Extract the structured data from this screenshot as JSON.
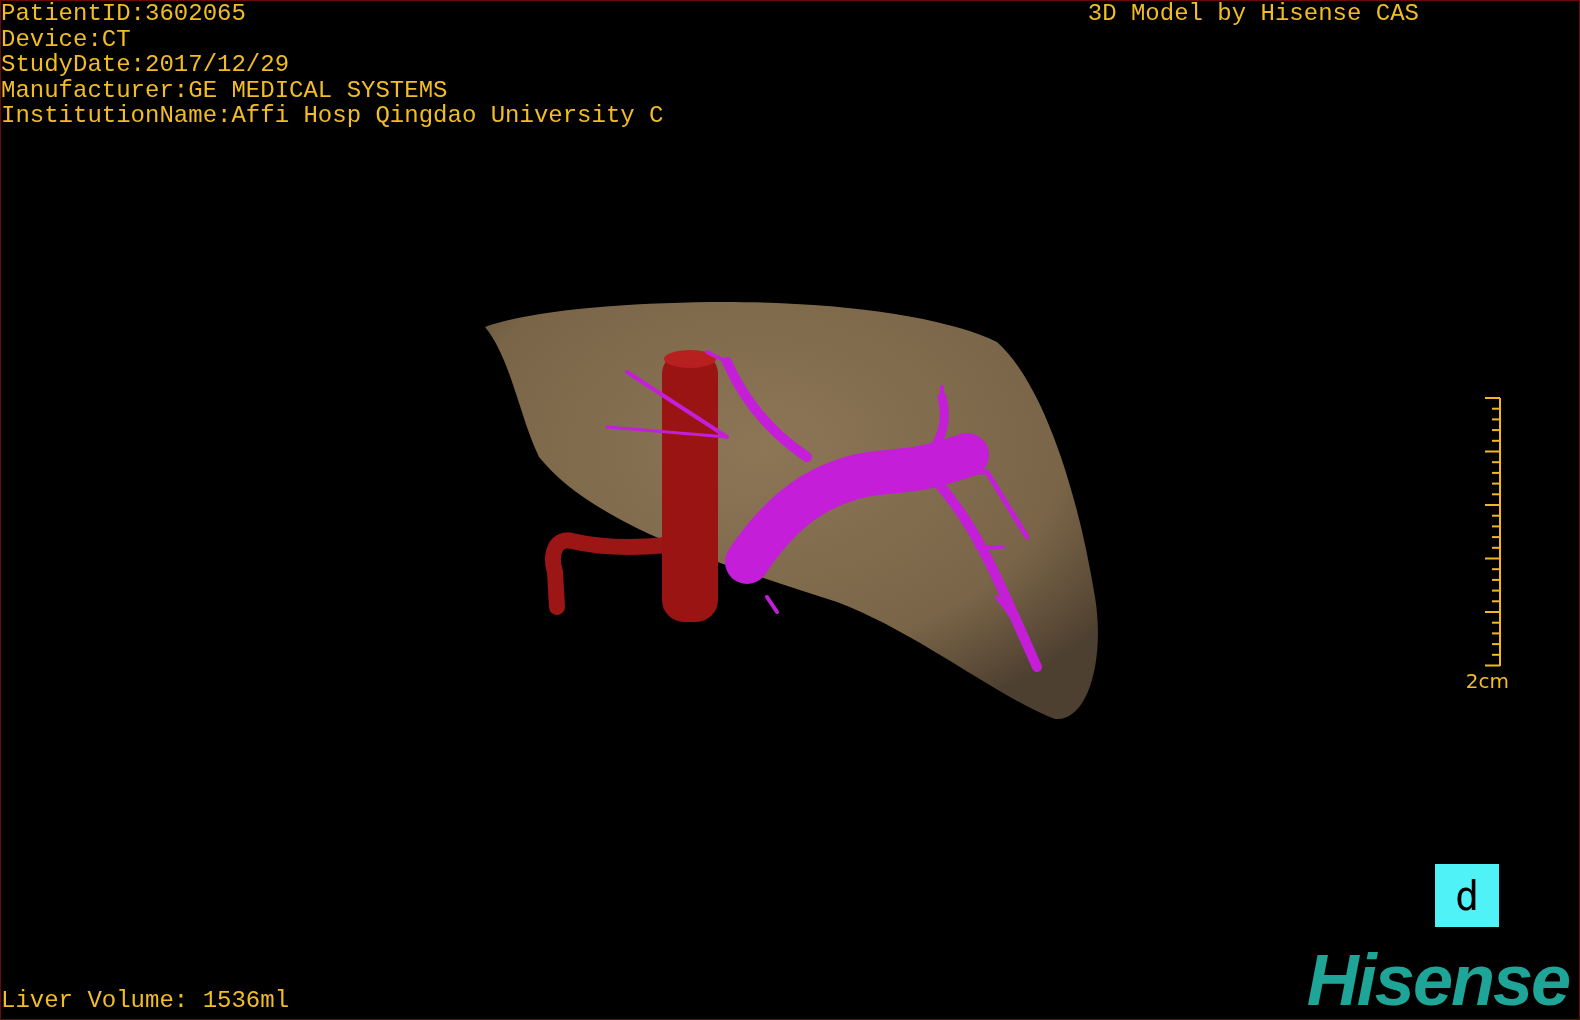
{
  "patient_info": [
    "PatientID:3602065",
    "Device:CT",
    "StudyDate:2017/12/29",
    "Manufacturer:GE MEDICAL SYSTEMS",
    "InstitutionName:Affi Hosp Qingdao University C"
  ],
  "title": "3D Model by Hisense CAS",
  "scale_bar": {
    "label": "2cm"
  },
  "view_button": {
    "label": "d"
  },
  "liver_volume": "Liver Volume: 1536ml",
  "logo": "Hisense"
}
